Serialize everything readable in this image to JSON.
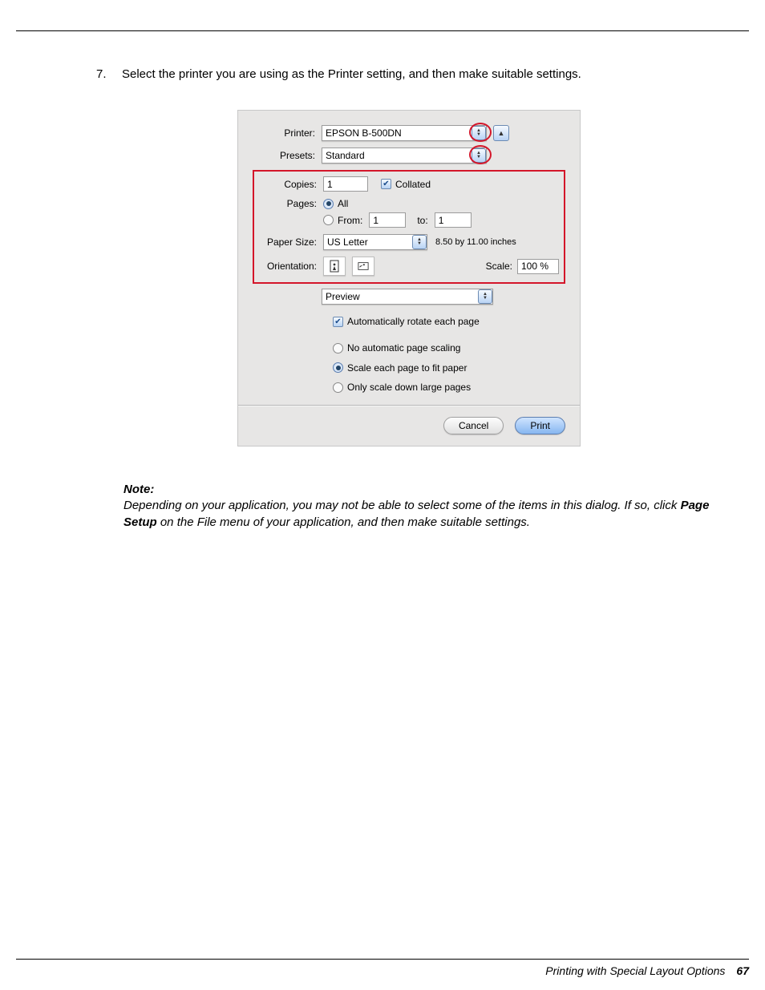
{
  "step": {
    "number": "7.",
    "text": "Select the printer you are using as the Printer setting, and then make suitable settings."
  },
  "dialog": {
    "labels": {
      "printer": "Printer:",
      "presets": "Presets:",
      "copies": "Copies:",
      "pages": "Pages:",
      "from": "From:",
      "to": "to:",
      "paper_size": "Paper Size:",
      "orientation": "Orientation:",
      "scale": "Scale:"
    },
    "values": {
      "printer": "EPSON B-500DN",
      "presets": "Standard",
      "copies": "1",
      "collated": "Collated",
      "pages_all": "All",
      "from": "1",
      "to": "1",
      "paper_size": "US Letter",
      "paper_dim": "8.50 by 11.00 inches",
      "scale": "100 %"
    },
    "section_select": "Preview",
    "auto_rotate": "Automatically rotate each page",
    "scaling": {
      "none": "No automatic page scaling",
      "fit": "Scale each page to fit paper",
      "down": "Only scale down large pages"
    },
    "buttons": {
      "cancel": "Cancel",
      "print": "Print"
    }
  },
  "note": {
    "title": "Note:",
    "line1_a": "Depending on your application, you may not be able to select some of the items in this dialog. If so, click ",
    "page_setup": "Page Setup",
    "line1_b": " on the File menu of your application, and then make suitable settings."
  },
  "footer": {
    "text": "Printing with Special Layout Options",
    "page": "67"
  }
}
